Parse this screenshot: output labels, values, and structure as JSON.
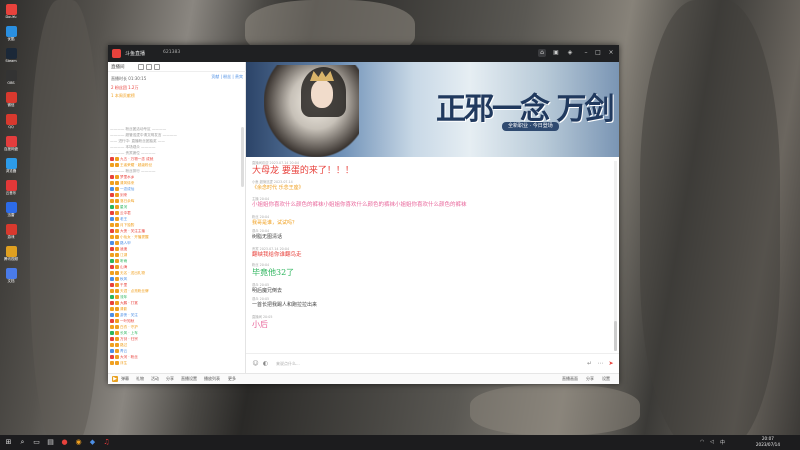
{
  "desktop": {
    "icons": [
      {
        "name": "douyu-desktop-icon",
        "label": "DouYu",
        "color": "#e8423c"
      },
      {
        "name": "app-desktop-icon-1",
        "label": "优酷",
        "color": "#2a8fe0"
      },
      {
        "name": "app-desktop-icon-2",
        "label": "Steam",
        "color": "#1b2838"
      },
      {
        "name": "app-desktop-icon-3",
        "label": "OBS",
        "color": "#333333"
      },
      {
        "name": "app-desktop-icon-4",
        "label": "微信",
        "color": "#d8392e"
      },
      {
        "name": "app-desktop-icon-5",
        "label": "QQ",
        "color": "#d8392e"
      },
      {
        "name": "app-desktop-icon-6",
        "label": "百度网盘",
        "color": "#e33d3d"
      },
      {
        "name": "app-desktop-icon-7",
        "label": "浏览器",
        "color": "#2d9be8"
      },
      {
        "name": "app-desktop-icon-8",
        "label": "云音乐",
        "color": "#e23838"
      },
      {
        "name": "app-desktop-icon-9",
        "label": "迅雷",
        "color": "#2d6be8"
      },
      {
        "name": "app-desktop-icon-10",
        "label": "游戏",
        "color": "#d8392e"
      },
      {
        "name": "app-desktop-icon-11",
        "label": "腾讯视频",
        "color": "#e0a020"
      },
      {
        "name": "app-desktop-icon-12",
        "label": "文档",
        "color": "#4a7be8"
      }
    ]
  },
  "window": {
    "room_name": "斗鱼直播",
    "room_id": "621383",
    "controls": [
      "home-icon",
      "gift-icon",
      "game-icon",
      "minimize-icon",
      "maximize-icon",
      "close-icon"
    ]
  },
  "left_panel": {
    "header": "直播间",
    "anchor_rows": [
      "直播时长 01:30:15",
      "2 粉丝团 1.2万",
      "1 本周贡献榜"
    ],
    "tabs": "贡献 | 粉丝 | 贵宾",
    "rank_rows": [
      {
        "text": "———— 粉丝团活动专区 ————",
        "sep": true,
        "color": "#999999"
      },
      {
        "text": "———— 超管巡逻中请文明发言 ————",
        "sep": true,
        "color": "#999999"
      },
      {
        "text": "—— 进行中: 直播粉丝团抽奖 ——",
        "sep": true,
        "color": "#999999"
      },
      {
        "text": "———— 本场观众 ————",
        "sep": true,
        "color": "#999999"
      },
      {
        "text": "———— 贵宾席位 ————",
        "sep": true,
        "color": "#999999"
      },
      {
        "text": "九五 · 万物一念 成就",
        "sep": false,
        "color": "#e8423c"
      },
      {
        "text": "王者荣耀 · 超级粉丝",
        "sep": false,
        "color": "#f0a020"
      },
      {
        "text": "———— 粉丝排行 ————",
        "sep": true,
        "color": "#999999"
      },
      {
        "text": "梦里水乡",
        "sep": false,
        "color": "#e8423c"
      },
      {
        "text": "清风徐来",
        "sep": false,
        "color": "#f0a020"
      },
      {
        "text": "一念成仙",
        "sep": false,
        "color": "#4d8fe5"
      },
      {
        "text": "剑来",
        "sep": false,
        "color": "#e8423c"
      },
      {
        "text": "落日余晖",
        "sep": false,
        "color": "#f0a020"
      },
      {
        "text": "星河",
        "sep": false,
        "color": "#2db55d"
      },
      {
        "text": "云中君",
        "sep": false,
        "color": "#e8423c"
      },
      {
        "text": "老王",
        "sep": false,
        "color": "#4d8fe5"
      },
      {
        "text": "月下独酌",
        "sep": false,
        "color": "#f0a020"
      },
      {
        "text": "大侠 · 关注主播",
        "sep": false,
        "color": "#e8423c"
      },
      {
        "text": "小仙女 · 开播提醒",
        "sep": false,
        "color": "#f0a020"
      },
      {
        "text": "路人甲",
        "sep": false,
        "color": "#4d8fe5"
      },
      {
        "text": "逍遥",
        "sep": false,
        "color": "#e8423c"
      },
      {
        "text": "江湖",
        "sep": false,
        "color": "#f0a020"
      },
      {
        "text": "听雨",
        "sep": false,
        "color": "#2db55d"
      },
      {
        "text": "山海",
        "sep": false,
        "color": "#e8423c"
      },
      {
        "text": "无名 · 送出礼物",
        "sep": false,
        "color": "#f0a020"
      },
      {
        "text": "秋风",
        "sep": false,
        "color": "#4d8fe5"
      },
      {
        "text": "千里",
        "sep": false,
        "color": "#e8423c"
      },
      {
        "text": "天涯 · 点亮粉丝牌",
        "sep": false,
        "color": "#f0a020"
      },
      {
        "text": "流年",
        "sep": false,
        "color": "#2db55d"
      },
      {
        "text": "大鹏 · 打赏",
        "sep": false,
        "color": "#e8423c"
      },
      {
        "text": "清影",
        "sep": false,
        "color": "#f0a020"
      },
      {
        "text": "游侠 · 关注",
        "sep": false,
        "color": "#4d8fe5"
      },
      {
        "text": "一叶知秋",
        "sep": false,
        "color": "#e8423c"
      },
      {
        "text": "白衣 · 守护",
        "sep": false,
        "color": "#f0a020"
      },
      {
        "text": "长风 · 上车",
        "sep": false,
        "color": "#2db55d"
      },
      {
        "text": "万剑 · 归宗",
        "sep": false,
        "color": "#e8423c"
      },
      {
        "text": "路过",
        "sep": false,
        "color": "#f0a020"
      },
      {
        "text": "青云",
        "sep": false,
        "color": "#4d8fe5"
      },
      {
        "text": "大河 · 粉丝",
        "sep": false,
        "color": "#e8423c"
      },
      {
        "text": "浮生",
        "sep": false,
        "color": "#f0a020"
      }
    ],
    "bottom_items": [
      "主播",
      "贵宾",
      "粉丝",
      "活动",
      "直播设置",
      "播放列表",
      "更多"
    ]
  },
  "banner": {
    "slogan": "正邪一念 万剑",
    "subtitle": "全新职业 · 今日登场"
  },
  "chat": {
    "messages": [
      {
        "meta": "直播间欢迎 2023.07.14 20:04",
        "text": "大母龙 要蛋的来了！！！",
        "color": "#e8423c",
        "size": 9
      },
      {
        "meta": "小鱼 超管巡逻 2023.07.14",
        "text": "《余念时代 乐念王座》",
        "color": "#f0a020",
        "size": 5
      },
      {
        "meta": "主播 20:04",
        "text": "小姐姐你喜欢什么颜色的裤袜小姐姐你喜欢什么颜色的裤袜小姐姐你喜欢什么颜色的裤袜",
        "color": "#e8659a",
        "size": 5.5
      },
      {
        "meta": "粉丝 20:04",
        "text": "我哥是谁，试试吗？",
        "color": "#f0a020",
        "size": 5
      },
      {
        "meta": "观众 20:04",
        "text": "树脂无图清话",
        "color": "#444444",
        "size": 5
      },
      {
        "meta": "贵宾 2023.07.14 20:04",
        "text": "翻峡我给你谁翻鸟走",
        "color": "#e8423c",
        "size": 5.5
      },
      {
        "meta": "粉丝 20:04",
        "text": "毕竟他32了",
        "color": "#2db55d",
        "size": 8
      },
      {
        "meta": "观众 20:05",
        "text": "明后魔兄倒去",
        "color": "#444444",
        "size": 5
      },
      {
        "meta": "观众 20:05",
        "text": "一首长把我踢人和跑拉拉出来",
        "color": "#444444",
        "size": 5
      },
      {
        "meta": "直播间 20:05",
        "text": "小后",
        "color": "#e8659a",
        "size": 8
      }
    ]
  },
  "input": {
    "placeholder": "来说点什么..."
  },
  "bottom_bar": {
    "left_items": [
      "弹幕",
      "礼物",
      "活动",
      "分享",
      "直播设置",
      "播放列表",
      "更多"
    ],
    "right_items": [
      "直播画面",
      "分享",
      "设置"
    ]
  },
  "taskbar": {
    "time": "20:07",
    "date": "2023/07/14"
  }
}
